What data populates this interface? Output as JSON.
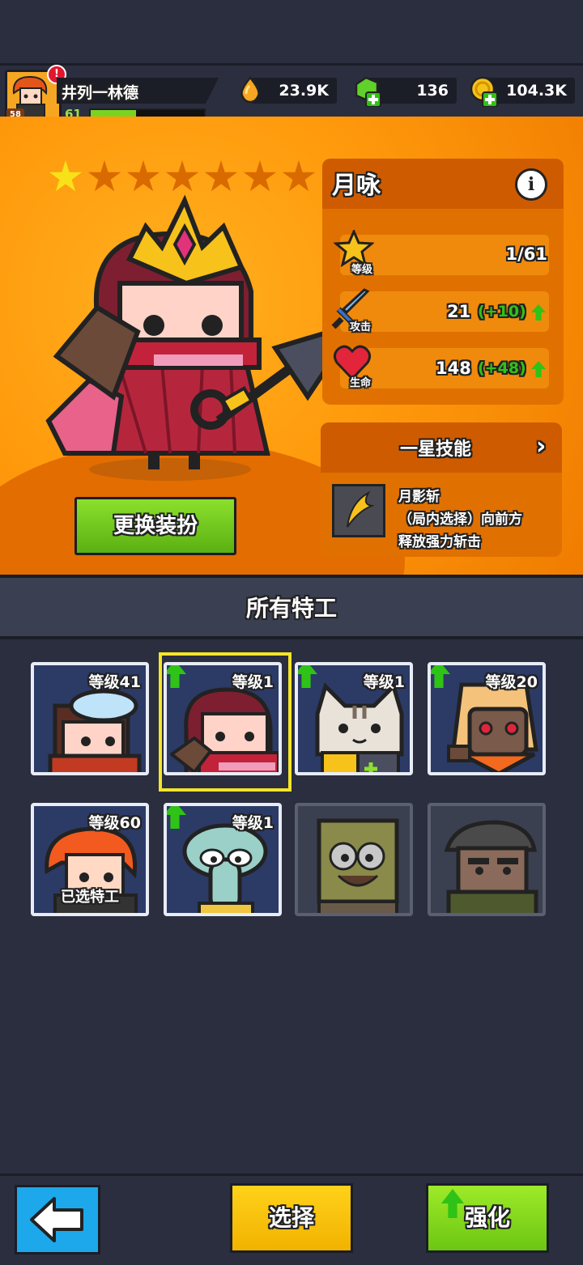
{
  "player": {
    "name": "井列一林德",
    "level": "61",
    "avatar_badge": "58",
    "alert": "!",
    "xp_progress": 0.4
  },
  "resources": {
    "drops": "23.9K",
    "gems": "136",
    "coins": "104.3K"
  },
  "hero": {
    "name": "月咏",
    "stars_filled": 1,
    "stars_total": 7,
    "stats": {
      "level_label": "等级",
      "level_value": "1/61",
      "attack_label": "攻击",
      "attack_value": "21",
      "attack_bonus": "(+10)",
      "hp_label": "生命",
      "hp_value": "148",
      "hp_bonus": "(+48)"
    },
    "skill": {
      "title": "一星技能",
      "name": "月影斩",
      "desc_line1": "（局内选择）向前方",
      "desc_line2": "释放强力斩击"
    },
    "change_skin_label": "更换装扮"
  },
  "section_title": "所有特工",
  "agents": [
    {
      "id": "agent-goggles",
      "level": "等级41",
      "upgradable": false,
      "locked": false,
      "selected_label": ""
    },
    {
      "id": "agent-yueyong",
      "level": "等级1",
      "upgradable": true,
      "locked": false,
      "selected_label": ""
    },
    {
      "id": "agent-cat",
      "level": "等级1",
      "upgradable": true,
      "locked": false,
      "selected_label": ""
    },
    {
      "id": "agent-masked",
      "level": "等级20",
      "upgradable": true,
      "locked": false,
      "selected_label": ""
    },
    {
      "id": "agent-redhair",
      "level": "等级60",
      "upgradable": false,
      "locked": false,
      "selected_label": "已选特工"
    },
    {
      "id": "agent-squid",
      "level": "等级1",
      "upgradable": true,
      "locked": false,
      "selected_label": ""
    },
    {
      "id": "agent-sponge",
      "level": "",
      "upgradable": false,
      "locked": true,
      "selected_label": ""
    },
    {
      "id": "agent-soldier",
      "level": "",
      "upgradable": false,
      "locked": true,
      "selected_label": ""
    }
  ],
  "buttons": {
    "select_label": "选择",
    "enhance_label": "强化"
  },
  "colors": {
    "hero_bg": "#ff9a0c",
    "panel_dark": "#2b2e3e",
    "bonus_green": "#2fc217",
    "highlight": "#f3e52a"
  }
}
